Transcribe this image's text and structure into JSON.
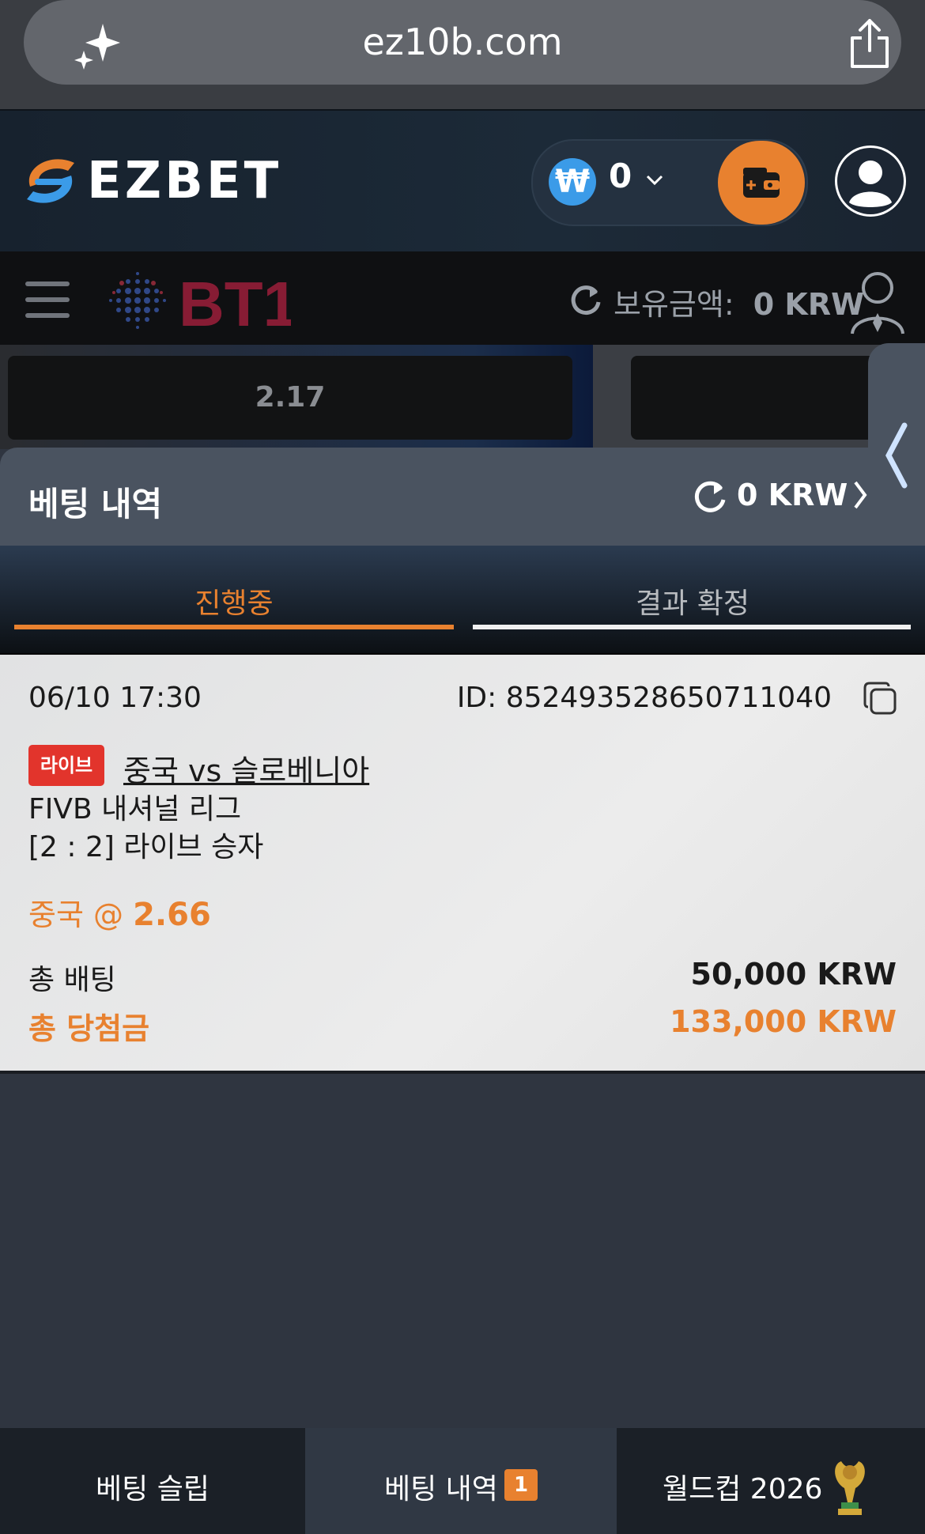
{
  "browser": {
    "url": "ez10b.com",
    "sparkle_icon": "sparkle-icon",
    "share_icon": "share-icon"
  },
  "header": {
    "brand": "EZBET",
    "currency_symbol": "₩",
    "balance": "0",
    "accent_color": "#e8812f"
  },
  "bt1": {
    "brand": "BT1",
    "balance_label": "보유금액:",
    "balance_value": "0 KRW"
  },
  "odds": {
    "first": "2.17"
  },
  "history": {
    "title": "베팅 내역",
    "balance": "0 KRW",
    "tabs": [
      {
        "label": "진행중",
        "active": true
      },
      {
        "label": "결과 확정",
        "active": false
      }
    ]
  },
  "bet": {
    "datetime": "06/10 17:30",
    "id": "ID: 852493528650711040",
    "badge": "라이브",
    "match": "중국 vs 슬로베니아",
    "league": "FIVB 내셔널 리그",
    "market": "[2 : 2] 라이브 승자",
    "pick": "중국 @",
    "pick_odds": "2.66",
    "total_bet_label": "총 배팅",
    "total_bet_value": "50,000 KRW",
    "total_win_label": "총 당첨금",
    "total_win_value": "133,000 KRW"
  },
  "bottom_nav": {
    "items": [
      {
        "label": "베팅 슬립"
      },
      {
        "label": "베팅 내역",
        "badge": "1"
      },
      {
        "label": "월드컵 2026"
      }
    ]
  }
}
